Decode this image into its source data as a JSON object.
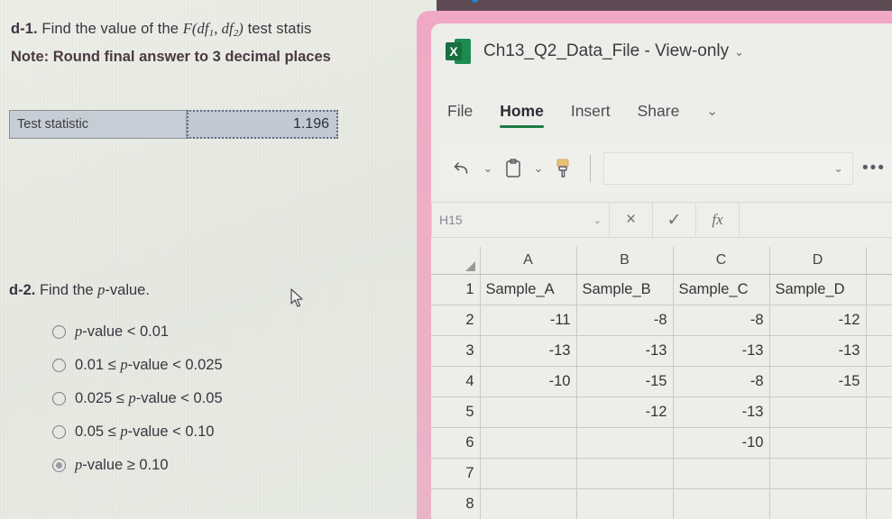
{
  "question": {
    "d1": {
      "label": "d-1.",
      "text_before": "Find the value of the",
      "stat_f": "F",
      "df1": "df",
      "df1_sub": "1",
      "df2": "df",
      "df2_sub": "2",
      "text_after": "test statis",
      "note": "Note: Round final answer to 3 decimal places"
    },
    "answer_table": {
      "label": "Test statistic",
      "value": "1.196"
    },
    "d2": {
      "label": "d-2.",
      "text": "Find the p-value.",
      "options": [
        {
          "text": "p-value < 0.01",
          "selected": false
        },
        {
          "text": "0.01 ≤ p-value < 0.025",
          "selected": false
        },
        {
          "text": "0.025 ≤ p-value < 0.05",
          "selected": false
        },
        {
          "text": "0.05 ≤ p-value < 0.10",
          "selected": false
        },
        {
          "text": "p-value ≥ 0.10",
          "selected": true
        }
      ]
    }
  },
  "excel": {
    "logo_letter": "X",
    "title": "Ch13_Q2_Data_File  -  View-only",
    "title_chevron": "⌄",
    "tabs": [
      {
        "label": "File",
        "active": false
      },
      {
        "label": "Home",
        "active": true
      },
      {
        "label": "Insert",
        "active": false
      },
      {
        "label": "Share",
        "active": false
      }
    ],
    "tabs_chevron": "⌄",
    "toolbar": {
      "undo_icon": "undo-icon",
      "undo_chevron": "⌄",
      "paste_icon": "clipboard-icon",
      "paste_chevron": "⌄",
      "format_painter_icon": "format-painter-icon",
      "field_chevron": "⌄",
      "overflow": "•••"
    },
    "formula_bar": {
      "name_box": "H15",
      "name_box_chevron": "⌄",
      "cancel": "×",
      "confirm": "✓",
      "fx": "fx",
      "input_value": ""
    },
    "grid": {
      "columns": [
        "A",
        "B",
        "C",
        "D"
      ],
      "rows": [
        {
          "num": "1",
          "cells": [
            "Sample_A",
            "Sample_B",
            "Sample_C",
            "Sample_D"
          ],
          "header": true
        },
        {
          "num": "2",
          "cells": [
            "-11",
            "-8",
            "-8",
            "-12"
          ],
          "header": false
        },
        {
          "num": "3",
          "cells": [
            "-13",
            "-13",
            "-13",
            "-13"
          ],
          "header": false
        },
        {
          "num": "4",
          "cells": [
            "-10",
            "-15",
            "-8",
            "-15"
          ],
          "header": false
        },
        {
          "num": "5",
          "cells": [
            "",
            "-12",
            "-13",
            ""
          ],
          "header": false
        },
        {
          "num": "6",
          "cells": [
            "",
            "",
            "-10",
            ""
          ],
          "header": false
        },
        {
          "num": "7",
          "cells": [
            "",
            "",
            "",
            ""
          ],
          "header": false
        },
        {
          "num": "8",
          "cells": [
            "",
            "",
            "",
            ""
          ],
          "header": false
        }
      ]
    }
  }
}
